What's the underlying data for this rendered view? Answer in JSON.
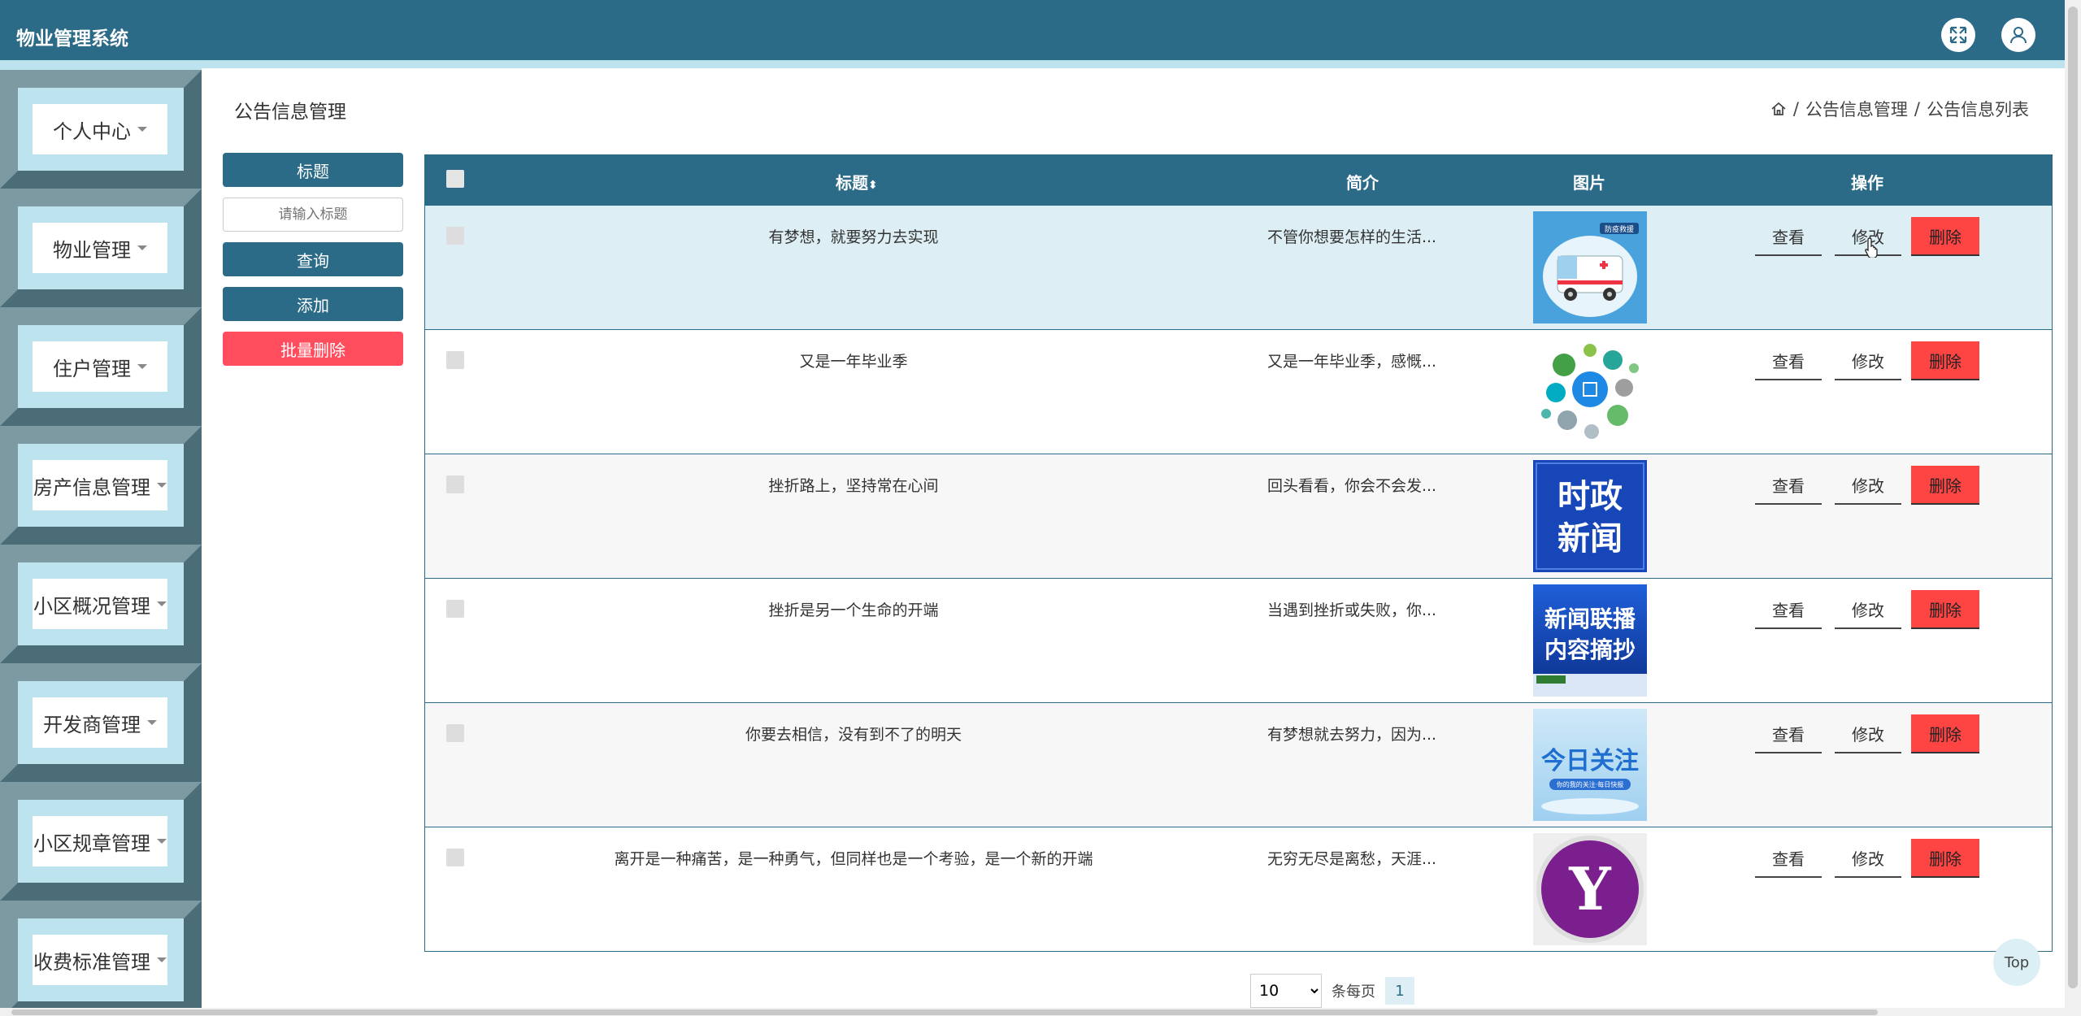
{
  "header": {
    "title": "物业管理系统"
  },
  "sidebar": {
    "items": [
      {
        "label": "个人中心"
      },
      {
        "label": "物业管理"
      },
      {
        "label": "住户管理"
      },
      {
        "label": "房产信息管理"
      },
      {
        "label": "小区概况管理"
      },
      {
        "label": "开发商管理"
      },
      {
        "label": "小区规章管理"
      },
      {
        "label": "收费标准管理"
      }
    ]
  },
  "page": {
    "title": "公告信息管理",
    "breadcrumb": [
      "公告信息管理",
      "公告信息列表"
    ]
  },
  "search": {
    "label": "标题",
    "placeholder": "请输入标题",
    "query_label": "查询",
    "add_label": "添加",
    "batch_delete_label": "批量删除"
  },
  "table": {
    "headers": {
      "title": "标题",
      "intro": "简介",
      "image": "图片",
      "actions": "操作"
    },
    "actions": {
      "view": "查看",
      "edit": "修改",
      "delete": "删除"
    },
    "rows": [
      {
        "title": "有梦想，就要努力去实现",
        "intro": "不管你想要怎样的生活...",
        "image": "救护车"
      },
      {
        "title": "又是一年毕业季",
        "intro": "又是一年毕业季，感慨...",
        "image": "圆点图"
      },
      {
        "title": "挫折路上，坚持常在心间",
        "intro": "回头看看，你会不会发...",
        "image": "时政新闻"
      },
      {
        "title": "挫折是另一个生命的开端",
        "intro": "当遇到挫折或失败，你...",
        "image": "新闻联播内容摘抄"
      },
      {
        "title": "你要去相信，没有到不了的明天",
        "intro": "有梦想就去努力，因为...",
        "image": "今日关注"
      },
      {
        "title": "离开是一种痛苦，是一种勇气，但同样也是一个考验，是一个新的开端",
        "intro": "无穷无尽是离愁，天涯...",
        "image": "Y"
      }
    ]
  },
  "thumb_text": {
    "ambulance_badge": "防疫救援",
    "news_line1": "时政",
    "news_line2": "新闻",
    "cctv_line1": "新闻联播",
    "cctv_line2": "内容摘抄",
    "focus": "今日关注",
    "focus_sub": "你的我的关注·每日快报",
    "y_letter": "Y"
  },
  "pagination": {
    "page_size": "10",
    "per_page_label": "条每页",
    "current_page": "1"
  },
  "top_button": "Top",
  "colors": {
    "primary": "#2b6b88",
    "danger": "#ff4d5e",
    "accent_light": "#bde3ef"
  }
}
